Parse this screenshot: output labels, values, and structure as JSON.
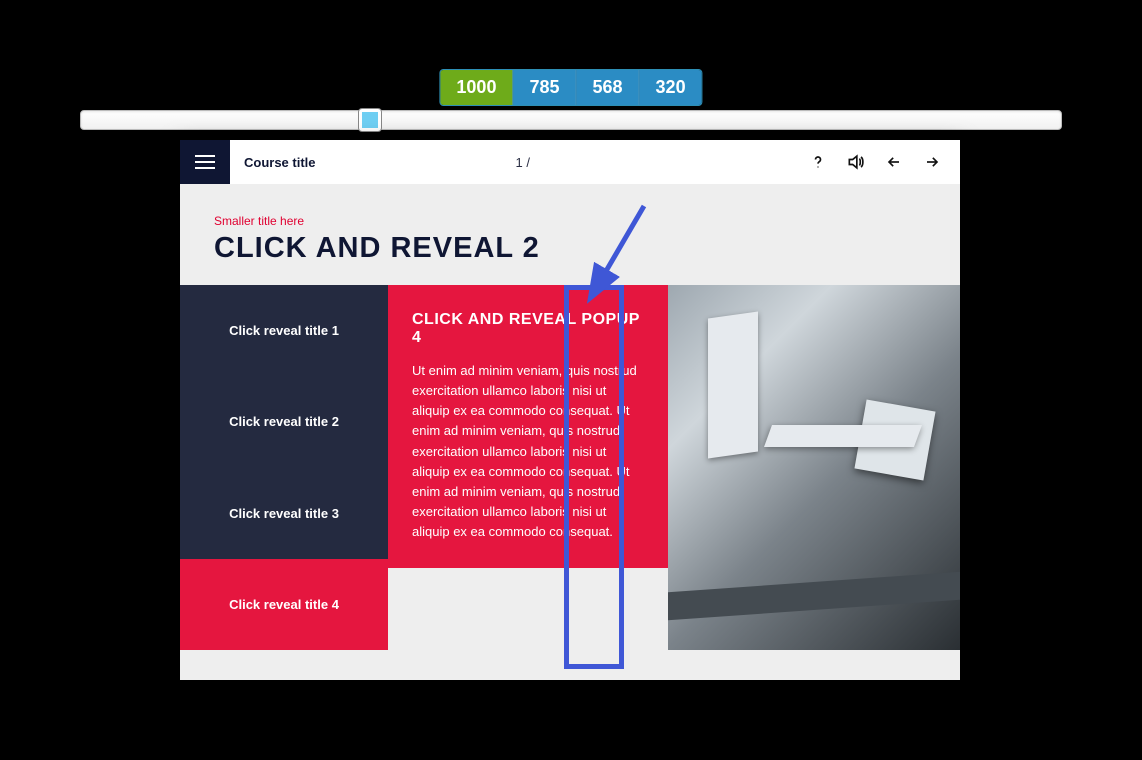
{
  "breakpoints": {
    "active": "1000",
    "b1": "1000",
    "b2": "785",
    "b3": "568",
    "b4": "320"
  },
  "topbar": {
    "course_title": "Course title",
    "page_count": "1 /"
  },
  "heading": {
    "small": "Smaller title here",
    "big": "CLICK AND REVEAL 2"
  },
  "reveal": {
    "item1": "Click reveal title 1",
    "item2": "Click reveal title 2",
    "item3": "Click reveal title 3",
    "item4": "Click reveal title 4",
    "active_index": 3
  },
  "popup": {
    "title": "CLICK AND REVEAL POPUP 4",
    "body": "Ut enim ad minim veniam, quis nostrud exercitation ullamco laboris nisi ut aliquip ex ea commodo consequat. Ut enim ad minim veniam, quis nostrud exercitation ullamco laboris nisi ut aliquip ex ea commodo consequat. Ut enim ad minim veniam, quis nostrud exercitation ullamco laboris nisi ut aliquip ex ea commodo consequat."
  }
}
